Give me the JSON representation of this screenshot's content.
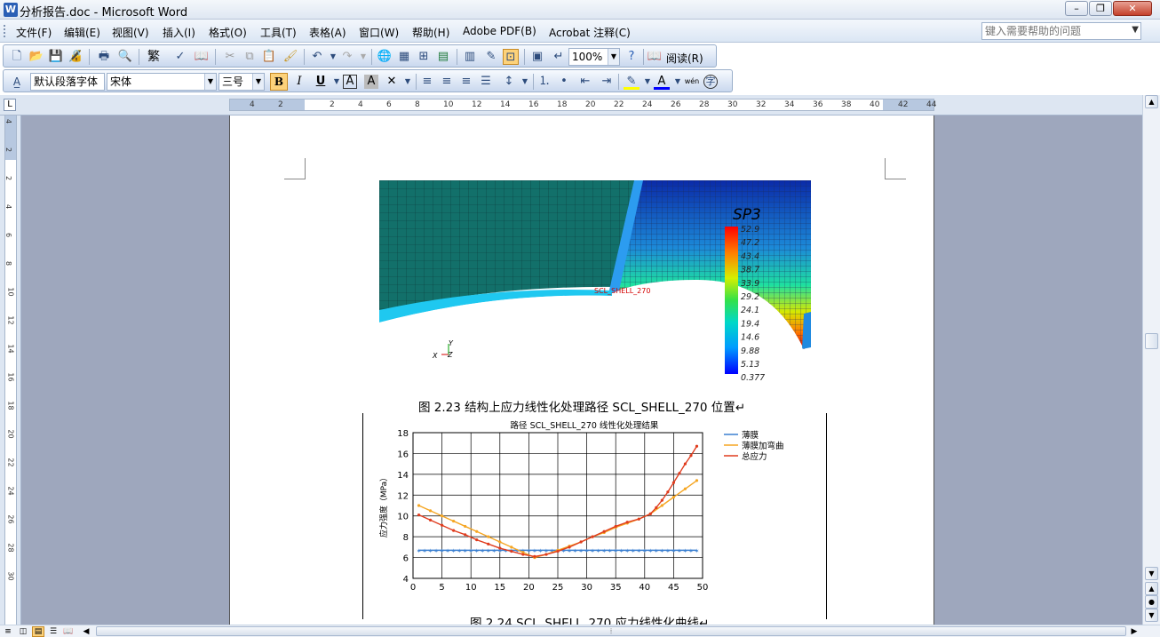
{
  "window": {
    "title": "分析报告.doc - Microsoft Word"
  },
  "menu": {
    "items": [
      "文件(F)",
      "编辑(E)",
      "视图(V)",
      "插入(I)",
      "格式(O)",
      "工具(T)",
      "表格(A)",
      "窗口(W)",
      "帮助(H)",
      "Adobe PDF(B)",
      "Acrobat 注释(C)"
    ],
    "help_placeholder": "键入需要帮助的问题"
  },
  "standard_toolbar": {
    "traditional_label": "繁",
    "zoom": "100%",
    "reading_label": "阅读(R)"
  },
  "formatting_toolbar": {
    "style": "默认段落字体",
    "font": "宋体",
    "size": "三号",
    "bold": "B",
    "italic": "I",
    "underline": "U",
    "pinyin_label": "wén"
  },
  "ruler": {
    "horizontal_numbers": [
      "4",
      "2",
      "2",
      "4",
      "6",
      "8",
      "10",
      "12",
      "14",
      "16",
      "18",
      "20",
      "22",
      "24",
      "26",
      "28",
      "30",
      "32",
      "34",
      "36",
      "38",
      "40",
      "42",
      "44"
    ],
    "vertical_numbers": [
      "4",
      "2",
      "2",
      "4",
      "6",
      "8",
      "10",
      "12",
      "14",
      "16",
      "18",
      "20",
      "22",
      "24",
      "26",
      "28",
      "30"
    ],
    "corner_glyph": "L"
  },
  "fea_figure": {
    "legend_title": "SP3",
    "legend_values": [
      "52.9",
      "47.2",
      "43.4",
      "38.7",
      "33.9",
      "29.2",
      "24.1",
      "19.4",
      "14.6",
      "9.88",
      "5.13",
      "0.377"
    ],
    "path_label": "SCL_SHELL_270",
    "axis_x": "X",
    "axis_y": "Y",
    "axis_z": "Z"
  },
  "captions": {
    "fig223": "图 2.23 结构上应力线性化处理路径 SCL_SHELL_270 位置↵",
    "fig224": "图 2.24 SCL_SHELL_270 应力线性化曲线↵"
  },
  "chart_data": {
    "type": "line",
    "title": "路径 SCL_SHELL_270 线性化处理结果",
    "xlabel": "",
    "ylabel": "应力强度（MPa）",
    "xlim": [
      0,
      50
    ],
    "ylim": [
      4,
      18
    ],
    "xticks": [
      0,
      5,
      10,
      15,
      20,
      25,
      30,
      35,
      40,
      45,
      50
    ],
    "yticks": [
      4,
      6,
      8,
      10,
      12,
      14,
      16,
      18
    ],
    "grid": true,
    "legend_position": "right",
    "series": [
      {
        "name": "薄膜",
        "color": "#3a7fd0",
        "marker": "star",
        "x": [
          1,
          2,
          3,
          4,
          5,
          6,
          7,
          8,
          9,
          10,
          11,
          12,
          13,
          14,
          15,
          16,
          17,
          18,
          19,
          20,
          21,
          22,
          23,
          24,
          25,
          26,
          27,
          28,
          29,
          30,
          31,
          32,
          33,
          34,
          35,
          36,
          37,
          38,
          39,
          40,
          41,
          42,
          43,
          44,
          45,
          46,
          47,
          48,
          49
        ],
        "y": [
          6.7,
          6.7,
          6.7,
          6.7,
          6.7,
          6.7,
          6.7,
          6.7,
          6.7,
          6.7,
          6.7,
          6.7,
          6.7,
          6.7,
          6.7,
          6.7,
          6.7,
          6.7,
          6.7,
          6.7,
          6.7,
          6.7,
          6.7,
          6.7,
          6.7,
          6.7,
          6.7,
          6.7,
          6.7,
          6.7,
          6.7,
          6.7,
          6.7,
          6.7,
          6.7,
          6.7,
          6.7,
          6.7,
          6.7,
          6.7,
          6.7,
          6.7,
          6.7,
          6.7,
          6.7,
          6.7,
          6.7,
          6.7,
          6.7
        ]
      },
      {
        "name": "薄膜加弯曲",
        "color": "#f5a623",
        "marker": "circle",
        "x": [
          1,
          3,
          5,
          7,
          9,
          11,
          13,
          15,
          17,
          19,
          21,
          23,
          25,
          27,
          29,
          31,
          33,
          35,
          37,
          39,
          41,
          43,
          45,
          47,
          49
        ],
        "y": [
          11.0,
          10.5,
          10.0,
          9.5,
          9.0,
          8.5,
          8.0,
          7.5,
          7.0,
          6.5,
          6.0,
          6.3,
          6.7,
          7.1,
          7.5,
          8.0,
          8.4,
          8.9,
          9.3,
          9.7,
          10.2,
          11.0,
          11.8,
          12.6,
          13.4
        ]
      },
      {
        "name": "总应力",
        "color": "#e03c1e",
        "marker": "circle",
        "x": [
          1,
          3,
          5,
          7,
          9,
          11,
          13,
          15,
          17,
          19,
          21,
          23,
          25,
          27,
          29,
          31,
          33,
          35,
          37,
          39,
          41,
          42,
          43,
          44,
          45,
          46,
          47,
          48,
          49
        ],
        "y": [
          10.1,
          9.6,
          9.1,
          8.6,
          8.2,
          7.7,
          7.3,
          6.9,
          6.6,
          6.3,
          6.1,
          6.3,
          6.6,
          7.0,
          7.5,
          8.0,
          8.5,
          9.0,
          9.4,
          9.7,
          10.2,
          10.8,
          11.5,
          12.3,
          13.2,
          14.1,
          15.0,
          15.8,
          16.7
        ]
      }
    ]
  }
}
